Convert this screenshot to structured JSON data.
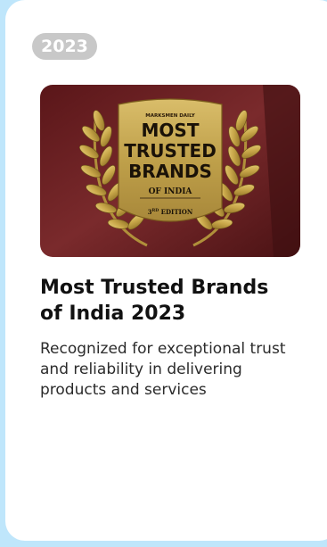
{
  "card": {
    "year_badge": "2023",
    "title_line1": "Most Trusted Brands",
    "title_line2": "of India 2023",
    "description": "Recognized for exceptional trust and reliability in delivering products and services",
    "image": {
      "publisher": "MARKSMEN DAILY",
      "line1": "MOST",
      "line2": "TRUSTED",
      "line3": "BRANDS",
      "line4": "OF INDIA",
      "edition_number": "3",
      "edition_suffix": "RD",
      "edition_word": " EDITION"
    }
  },
  "colors": {
    "page_background": "#bfe6fb",
    "badge_background": "#c8c8c8",
    "plaque_gold": "#c9a84a",
    "image_background": "#6a1f22"
  }
}
